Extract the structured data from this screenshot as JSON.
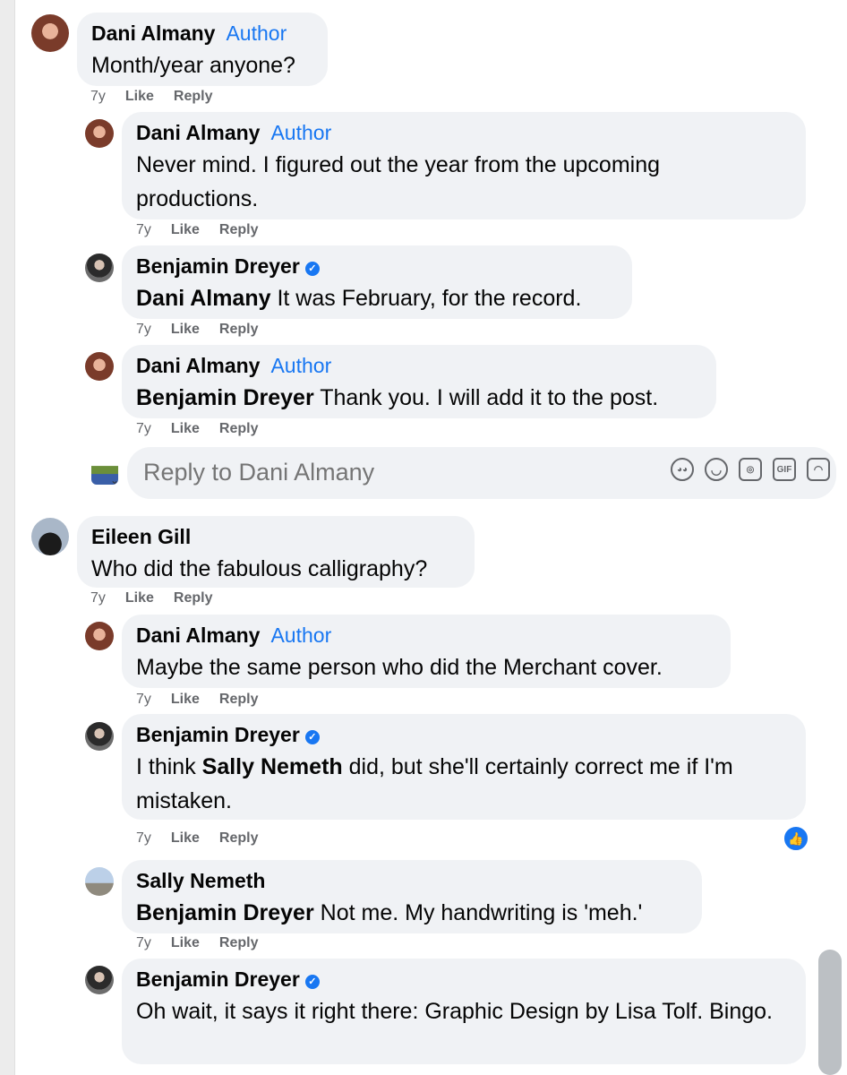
{
  "comments": [
    {
      "name": "Dani Almany",
      "badge": "Author",
      "text": "Month/year anyone?",
      "time": "7y",
      "like": "Like",
      "reply": "Reply"
    },
    {
      "name": "Dani Almany",
      "badge": "Author",
      "text": "Never mind. I figured out the year from the upcoming productions.",
      "time": "7y",
      "like": "Like",
      "reply": "Reply"
    },
    {
      "name": "Benjamin Dreyer",
      "mention": "Dani Almany",
      "text": " It was February, for the record.",
      "time": "7y",
      "like": "Like",
      "reply": "Reply"
    },
    {
      "name": "Dani Almany",
      "badge": "Author",
      "mention": "Benjamin Dreyer",
      "text": " Thank you. I will add it to the post.",
      "time": "7y",
      "like": "Like",
      "reply": "Reply"
    },
    {
      "name": "Eileen Gill",
      "text": "Who did the fabulous calligraphy?",
      "time": "7y",
      "like": "Like",
      "reply": "Reply"
    },
    {
      "name": "Dani Almany",
      "badge": "Author",
      "text": "Maybe the same person who did the Merchant cover.",
      "time": "7y",
      "like": "Like",
      "reply": "Reply"
    },
    {
      "name": "Benjamin Dreyer",
      "text_before": "I think ",
      "mention": "Sally Nemeth",
      "text": " did, but she'll certainly correct me if I'm mistaken.",
      "time": "7y",
      "like": "Like",
      "reply": "Reply"
    },
    {
      "name": "Sally Nemeth",
      "mention": "Benjamin Dreyer",
      "text": " Not me. My handwriting is 'meh.'",
      "time": "7y",
      "like": "Like",
      "reply": "Reply"
    },
    {
      "name": "Benjamin Dreyer",
      "text": "Oh wait, it says it right there: Graphic Design by Lisa Tolf. Bingo."
    }
  ],
  "reply_box": {
    "placeholder": "Reply to Dani Almany",
    "icons": [
      "avatar-sticker-icon",
      "emoji-icon",
      "camera-icon",
      "gif-icon",
      "sticker-icon"
    ],
    "gif_label": "GIF"
  },
  "reaction": {
    "icon": "thumbs-up-icon",
    "color": "#1877f2"
  },
  "colors": {
    "author_badge": "#1877f2",
    "bubble": "#f0f2f5",
    "meta": "#65676b"
  }
}
